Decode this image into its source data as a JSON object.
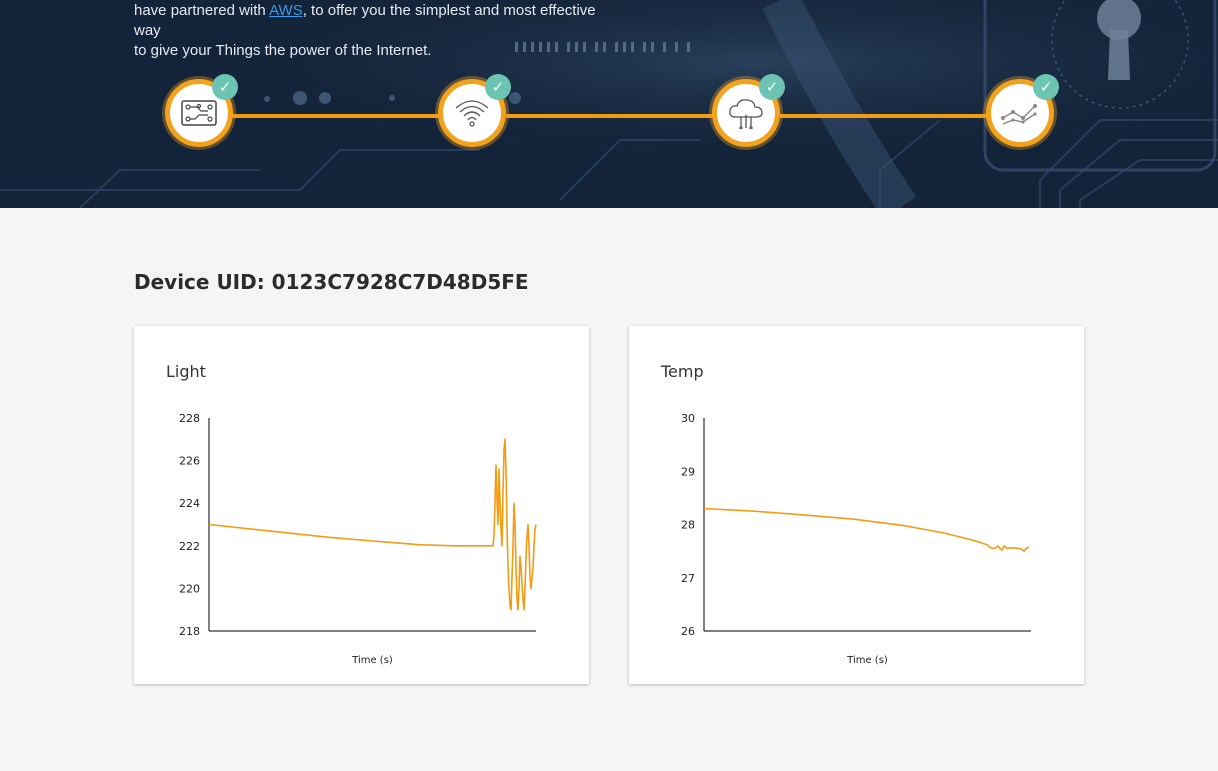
{
  "hero": {
    "line1_prefix": "have partnered with ",
    "line1_link": "AWS",
    "line1_suffix": ", to offer you the simplest and most effective way",
    "line2": "to give your Things the power of the Internet.",
    "steps": [
      {
        "icon": "circuit-board-icon",
        "done": true
      },
      {
        "icon": "wifi-icon",
        "done": true
      },
      {
        "icon": "cloud-icon",
        "done": true
      },
      {
        "icon": "line-graph-icon",
        "done": true
      }
    ],
    "check_glyph": "✓"
  },
  "device": {
    "title": "Device UID: 0123C7928C7D48D5FE"
  },
  "colors": {
    "accent": "#f39c12",
    "hero_bg": "#132339",
    "check": "#6cc4b3",
    "link": "#3a9be8"
  },
  "chart_data": [
    {
      "type": "line",
      "title": "Light",
      "xlabel": "Time (s)",
      "ylabel": "",
      "ylim": [
        218,
        228
      ],
      "yticks": [
        218,
        220,
        222,
        224,
        226,
        228
      ],
      "grid": false,
      "color": "#f39c12",
      "series": [
        {
          "x": [
            0,
            60,
            120,
            170,
            210,
            245,
            265,
            284,
            285,
            286,
            287,
            288,
            289,
            290,
            291,
            292,
            293,
            294,
            295,
            296,
            297,
            298,
            299,
            300,
            301,
            302,
            303,
            304,
            305,
            306,
            307,
            308,
            309,
            310,
            311,
            312,
            313,
            314,
            315,
            316,
            317,
            318,
            319,
            320,
            321,
            322,
            323,
            324,
            325,
            326,
            327
          ],
          "y": [
            223.0,
            222.7,
            222.4,
            222.2,
            222.05,
            222.0,
            222.0,
            222.0,
            222.5,
            224.0,
            225.8,
            224.2,
            223.0,
            225.6,
            224.0,
            222.8,
            222.0,
            224.5,
            226.5,
            227.0,
            225.5,
            223.0,
            221.0,
            220.0,
            219.2,
            219.0,
            220.5,
            222.0,
            224.0,
            223.0,
            221.0,
            219.5,
            219.0,
            220.0,
            221.5,
            221.0,
            220.2,
            219.5,
            219.0,
            220.0,
            221.5,
            222.4,
            223.0,
            222.0,
            220.5,
            220.0,
            220.5,
            221.0,
            222.0,
            222.8,
            223.0
          ]
        }
      ]
    },
    {
      "type": "line",
      "title": "Temp",
      "xlabel": "Time (s)",
      "ylabel": "",
      "ylim": [
        26,
        30
      ],
      "yticks": [
        26,
        27,
        28,
        29,
        30
      ],
      "grid": false,
      "color": "#f39c12",
      "series": [
        {
          "x": [
            0,
            50,
            100,
            150,
            200,
            240,
            270,
            283,
            286,
            289,
            292,
            294,
            296,
            298,
            300,
            303,
            306,
            310,
            315,
            318,
            320,
            322,
            325
          ],
          "y": [
            28.3,
            28.25,
            28.18,
            28.1,
            27.98,
            27.84,
            27.7,
            27.62,
            27.57,
            27.55,
            27.56,
            27.6,
            27.55,
            27.52,
            27.6,
            27.55,
            27.56,
            27.56,
            27.55,
            27.53,
            27.5,
            27.55,
            27.58
          ]
        }
      ]
    }
  ]
}
